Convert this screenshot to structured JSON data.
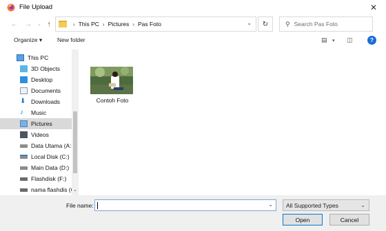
{
  "window": {
    "title": "File Upload",
    "close_glyph": "✕"
  },
  "address": {
    "crumbs": [
      "This PC",
      "Pictures",
      "Pas Foto"
    ],
    "search_placeholder": "Search Pas Foto"
  },
  "toolbar": {
    "organize_label": "Organize ▾",
    "new_folder_label": "New folder"
  },
  "sidebar": {
    "items": [
      {
        "label": "This PC",
        "icon": "computer-icon"
      },
      {
        "label": "3D Objects",
        "icon": "cube-icon"
      },
      {
        "label": "Desktop",
        "icon": "desktop-icon"
      },
      {
        "label": "Documents",
        "icon": "documents-icon"
      },
      {
        "label": "Downloads",
        "icon": "download-icon"
      },
      {
        "label": "Music",
        "icon": "music-icon"
      },
      {
        "label": "Pictures",
        "icon": "pictures-icon"
      },
      {
        "label": "Videos",
        "icon": "videos-icon"
      },
      {
        "label": "Data Utama (A:)",
        "icon": "drive-icon"
      },
      {
        "label": "Local Disk (C:)",
        "icon": "drive-icon"
      },
      {
        "label": "Main Data (D:)",
        "icon": "drive-icon"
      },
      {
        "label": "Flashdisk (F:)",
        "icon": "usb-drive-icon"
      },
      {
        "label": "nama flashdis (G",
        "icon": "usb-drive-icon"
      }
    ],
    "selected": "Pictures"
  },
  "files": [
    {
      "name": "Contoh Foto",
      "icon": "photo-thumbnail"
    }
  ],
  "bottom": {
    "file_name_label": "File name:",
    "file_name_value": "",
    "file_type_value": "All Supported Types",
    "open_label": "Open",
    "cancel_label": "Cancel"
  },
  "colors": {
    "accent": "#0078d7",
    "selected_bg": "#d9d9d9",
    "help": "#1a6fd6"
  }
}
